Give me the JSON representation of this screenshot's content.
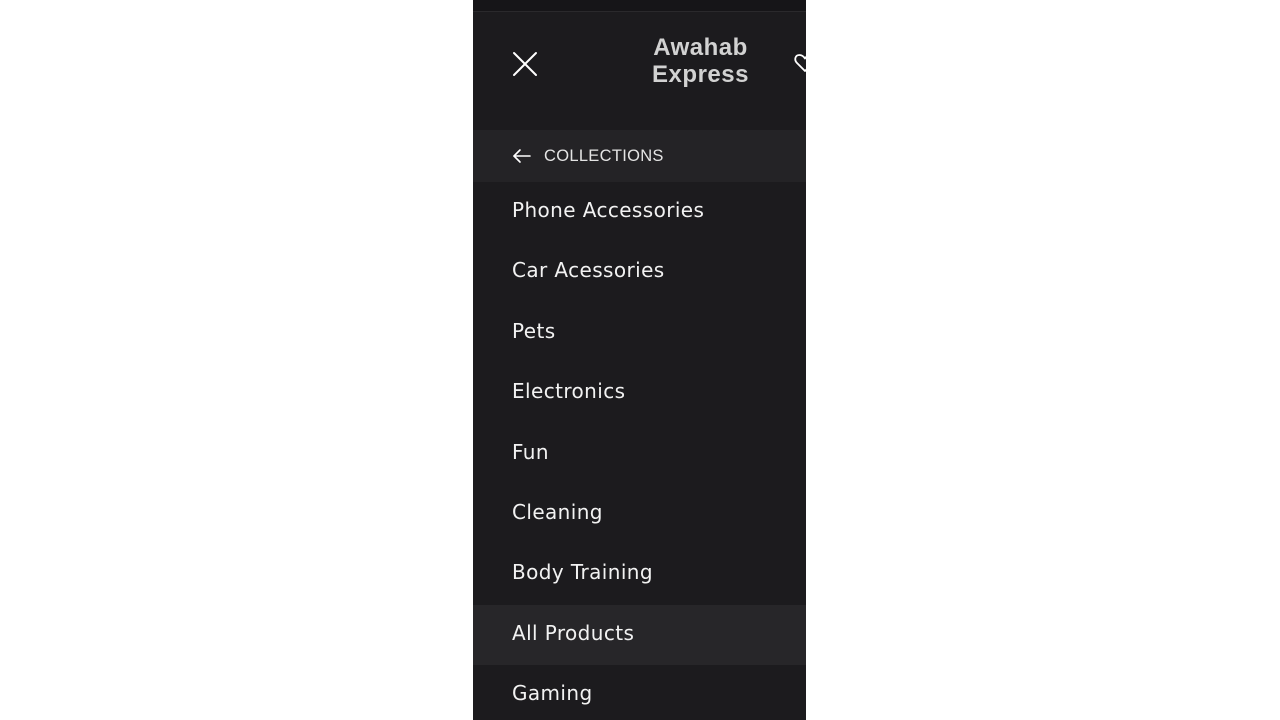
{
  "header": {
    "brand_line1": "Awahab",
    "brand_line2": "Express",
    "close_icon": "close-icon",
    "wishlist_icon": "heart-icon"
  },
  "collections": {
    "label": "COLLECTIONS",
    "back_icon": "arrow-left-icon"
  },
  "menu": {
    "items": [
      {
        "label": "Phone Accessories",
        "active": false
      },
      {
        "label": "Car Acessories",
        "active": false
      },
      {
        "label": "Pets",
        "active": false
      },
      {
        "label": "Electronics",
        "active": false
      },
      {
        "label": "Fun",
        "active": false
      },
      {
        "label": "Cleaning",
        "active": false
      },
      {
        "label": "Body Training",
        "active": false
      },
      {
        "label": "All Products",
        "active": true
      },
      {
        "label": "Gaming",
        "active": false
      }
    ]
  },
  "colors": {
    "background": "#1c1b1e",
    "highlight": "#272629",
    "text": "#f2f2f2",
    "brand_text": "#d2d2d2"
  }
}
